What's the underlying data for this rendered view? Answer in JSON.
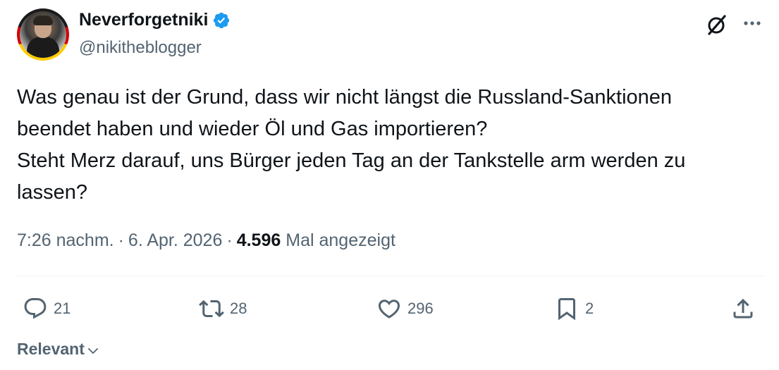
{
  "author": {
    "display_name": "Neverforgetniki",
    "handle": "@nikitheblogger",
    "verified": true
  },
  "tweet": {
    "text": "Was genau ist der Grund, dass wir nicht längst die Russland-Sanktionen\nbeendet haben und wieder Öl und Gas importieren?\nSteht Merz darauf, uns Bürger jeden Tag an der Tankstelle arm werden zu\nlassen?",
    "time": "7:26 nachm.",
    "sep": "·",
    "date": "6. Apr. 2026",
    "views_count": "4.596",
    "views_label": "Mal angezeigt"
  },
  "actions": {
    "replies": "21",
    "reposts": "28",
    "likes": "296",
    "bookmarks": "2"
  },
  "replies_sort": {
    "label": "Relevant"
  },
  "icons": {
    "verified": "verified-badge-icon",
    "grok": "grok-icon",
    "more": "more-dots-icon",
    "reply": "reply-bubble-icon",
    "repost": "repost-arrows-icon",
    "like": "heart-icon",
    "bookmark": "bookmark-icon",
    "share": "share-upload-icon",
    "sort": "chevron-down-icon"
  },
  "colors": {
    "verified_blue": "#1d9bf0",
    "text_primary": "#0f1419",
    "text_secondary": "#536471"
  }
}
